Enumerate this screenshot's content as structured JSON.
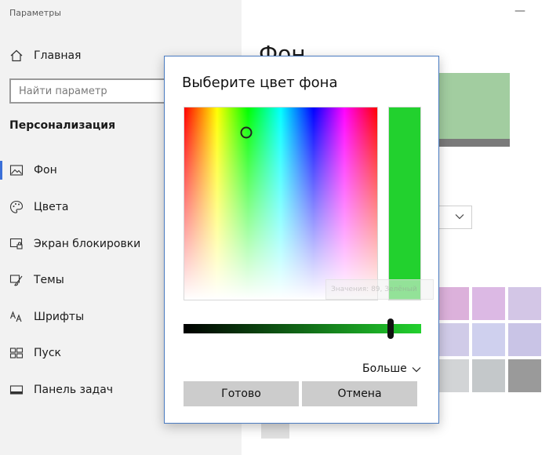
{
  "window": {
    "title": "Параметры"
  },
  "nav": {
    "home": "Главная",
    "search_placeholder": "Найти параметр",
    "section": "Персонализация",
    "items": [
      {
        "label": "Фон",
        "icon": "picture-icon",
        "active": true
      },
      {
        "label": "Цвета",
        "icon": "palette-icon"
      },
      {
        "label": "Экран блокировки",
        "icon": "lock-screen-icon"
      },
      {
        "label": "Темы",
        "icon": "themes-brush-icon"
      },
      {
        "label": "Шрифты",
        "icon": "fonts-icon"
      },
      {
        "label": "Пуск",
        "icon": "start-grid-icon"
      },
      {
        "label": "Панель задач",
        "icon": "taskbar-icon"
      }
    ]
  },
  "main": {
    "title": "Фон",
    "preview_color": "#a2cda0",
    "swatches": [
      "#dcb1db",
      "#dcb9e4",
      "#d3c6e6",
      "#d0cbe8",
      "#cfd0ee",
      "#c9c4e6",
      "#d2d4d6",
      "#c4c8ca",
      "#9a9a9a"
    ]
  },
  "dialog": {
    "title": "Выберите цвет фона",
    "selected_color": "#22d12e",
    "hue_degrees": 115,
    "saturation": 0.87,
    "value_fraction": 0.87,
    "more_label": "Больше",
    "ok_label": "Готово",
    "cancel_label": "Отмена",
    "ghost_tooltip": "Значения: 89, Зелёный"
  }
}
